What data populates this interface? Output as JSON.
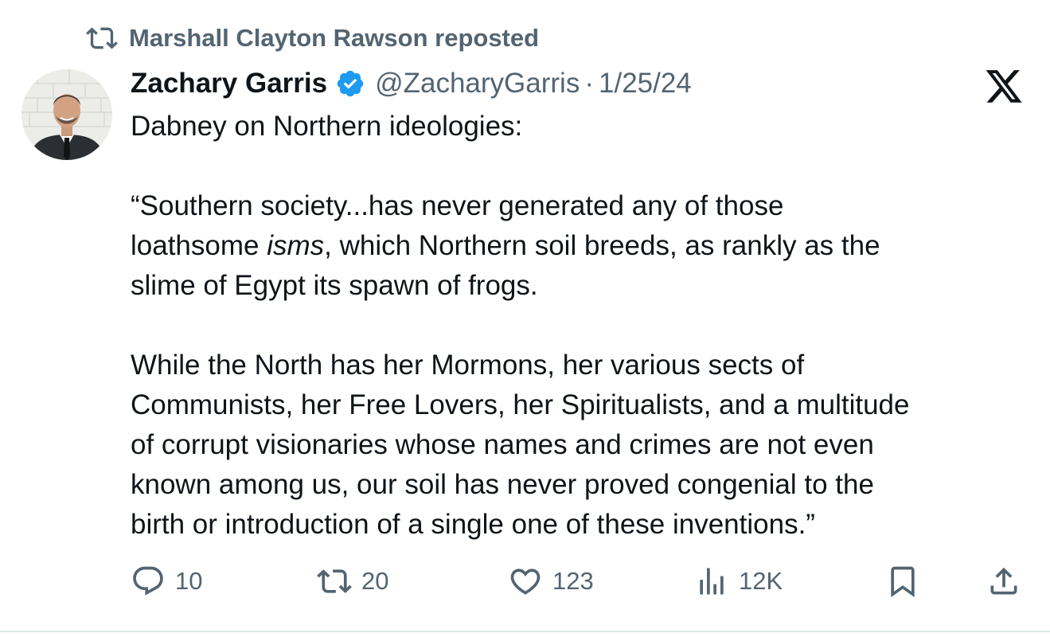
{
  "repost": {
    "icon": "repost-icon",
    "label": "Marshall Clayton Rawson reposted"
  },
  "tweet": {
    "author_name": "Zachary Garris",
    "verified": true,
    "verified_color": "#1d9bf0",
    "handle": "@ZacharyGarris",
    "separator": "·",
    "date": "1/25/24",
    "lines": {
      "l1": "Dabney on Northern ideologies:",
      "l2": "“Southern society...has never generated any of those",
      "l3_before": "loathsome ",
      "l3_italic": "isms",
      "l3_after": ", which Northern soil breeds, as rankly as the",
      "l4": "slime of Egypt its spawn of frogs.",
      "l5": "While the North has her Mormons, her various sects of",
      "l6": "Communists, her Free Lovers, her Spiritualists, and a multitude",
      "l7": "of corrupt visionaries whose names and crimes are not even",
      "l8": "known among us, our soil has never proved congenial to the",
      "l9": "birth or introduction of a single one of these inventions.”"
    }
  },
  "actions": {
    "replies": "10",
    "reposts": "20",
    "likes": "123",
    "views": "12K"
  },
  "brand": {
    "logo": "x-logo-icon"
  },
  "colors": {
    "text": "#0f1419",
    "secondary": "#536471",
    "divider": "#dce8e4"
  }
}
